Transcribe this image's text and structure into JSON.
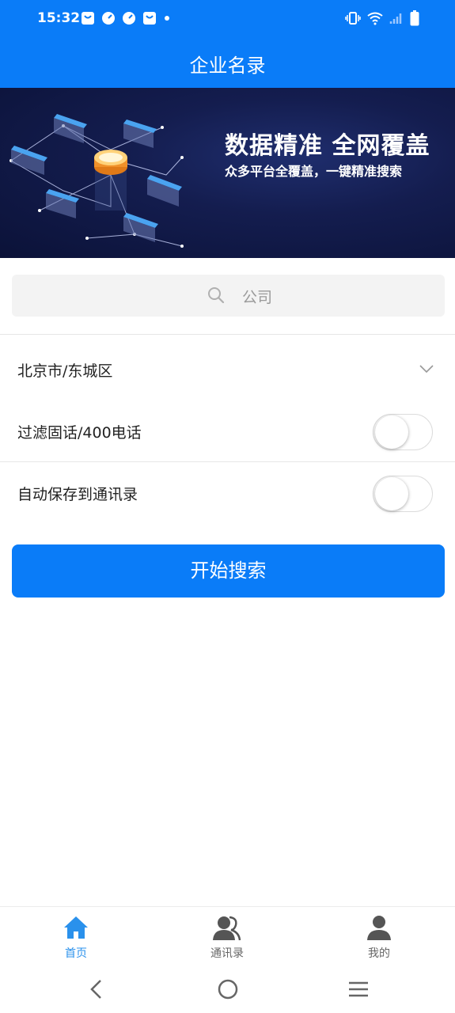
{
  "status_bar": {
    "time": "15:32",
    "left_icons": [
      "bag-notification-icon",
      "clock-app-icon",
      "clock-app-icon",
      "bag-notification-icon",
      "dot-icon"
    ],
    "right_icons": [
      "vibrate-icon",
      "wifi-icon",
      "signal-icon",
      "battery-icon"
    ]
  },
  "app_bar": {
    "title": "企业名录"
  },
  "banner": {
    "title": "数据精准 全网覆盖",
    "subtitle": "众多平台全覆盖，一键精准搜索"
  },
  "search": {
    "placeholder": "公司",
    "icon": "search-icon"
  },
  "filters": {
    "region": "北京市/东城区",
    "filter_landline_label": "过滤固话/400电话",
    "filter_landline_on": false,
    "auto_save_label": "自动保存到通讯录",
    "auto_save_on": false
  },
  "start_button": {
    "label": "开始搜索"
  },
  "tab_bar": {
    "tabs": [
      {
        "label": "首页",
        "icon": "home-icon",
        "active": true
      },
      {
        "label": "通讯录",
        "icon": "contacts-icon",
        "active": false
      },
      {
        "label": "我的",
        "icon": "profile-icon",
        "active": false
      }
    ]
  },
  "colors": {
    "primary": "#0a7cf8",
    "tab_active": "#2a91ec",
    "banner_dark": "#0b1238"
  }
}
